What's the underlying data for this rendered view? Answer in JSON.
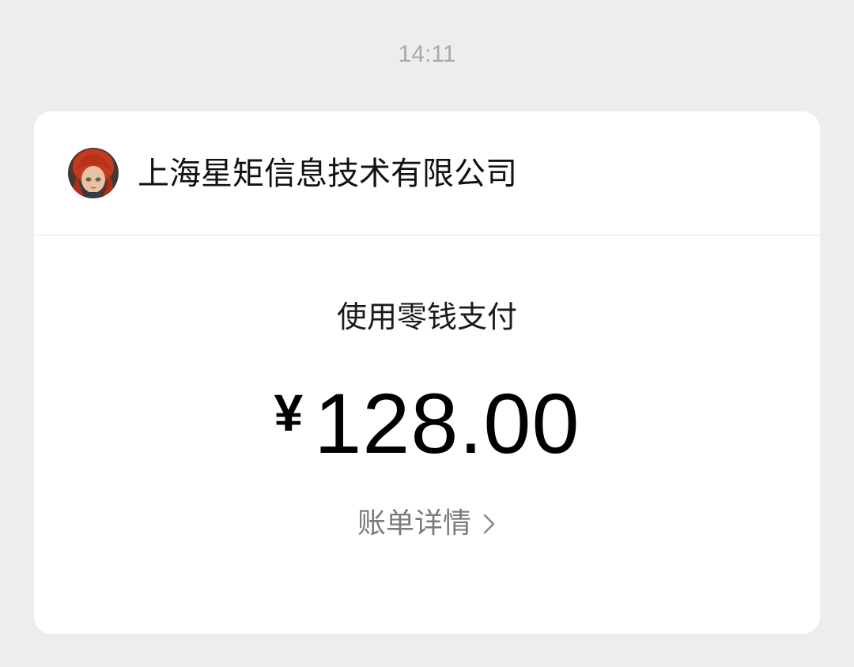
{
  "timestamp": "14:11",
  "merchant": {
    "name": "上海星矩信息技术有限公司",
    "avatar_icon": "merchant-avatar"
  },
  "payment": {
    "method_label": "使用零钱支付",
    "currency_symbol": "¥",
    "amount": "128.00"
  },
  "bill_details": {
    "label": "账单详情",
    "icon": "chevron-right-icon"
  },
  "colors": {
    "background": "#ededed",
    "card": "#ffffff",
    "muted_text": "#a9a9a9",
    "link_text": "#7a7a7a"
  }
}
